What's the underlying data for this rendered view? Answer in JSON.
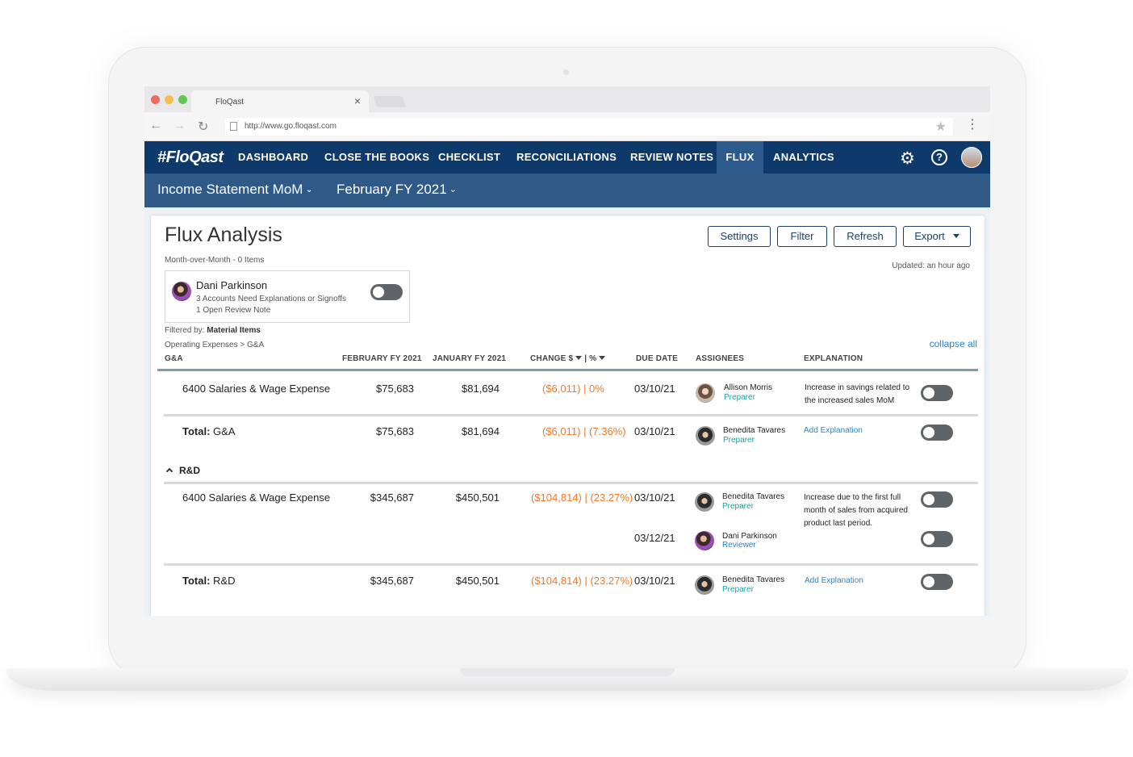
{
  "browser": {
    "tab_title": "FloQast",
    "tab_close": "×",
    "url": "http://www.go.floqast.com",
    "icons": {
      "back": "back-arrow-icon",
      "forward": "forward-arrow-icon",
      "reload": "reload-icon",
      "star": "star-icon",
      "menu": "kebab-menu-icon"
    },
    "window_dot_colors": [
      "#ee6a5f",
      "#f5be4f",
      "#62c554"
    ]
  },
  "app": {
    "logo": "#FloQast",
    "nav": [
      "DASHBOARD",
      "CLOSE THE BOOKS",
      "CHECKLIST",
      "RECONCILIATIONS",
      "REVIEW NOTES",
      "FLUX",
      "ANALYTICS"
    ],
    "active_nav": "FLUX",
    "help_glyph": "?",
    "subnav": {
      "statement": "Income Statement MoM",
      "period": "February FY 2021"
    },
    "colors": {
      "nav_bg": "#0e3a6b",
      "subnav_bg": "#2f5a88",
      "accent": "#2a86c9",
      "change_negative": "#ef7a2b",
      "role": "#1aa3a0"
    }
  },
  "page": {
    "title": "Flux Analysis",
    "subtitle": "Month-over-Month - 0 Items",
    "buttons": {
      "settings": "Settings",
      "filter": "Filter",
      "refresh": "Refresh",
      "export": "Export"
    },
    "updated": "Updated: an hour ago",
    "user_card": {
      "name": "Dani Parkinson",
      "line1": "3 Accounts Need Explanations or Signoffs",
      "line2": "1 Open Review Note",
      "toggle_on": false
    },
    "filtered_label": "Filtered by:",
    "filtered_value": "Material Items",
    "breadcrumb": "Operating Expenses > G&A",
    "collapse_all": "collapse all"
  },
  "table": {
    "columns": {
      "group": "G&A",
      "feb": "FEBRUARY FY 2021",
      "jan": "JANUARY FY 2021",
      "change": "CHANGE $",
      "change_sep": "| %",
      "due": "DUE DATE",
      "assignees": "ASSIGNEES",
      "explanation": "EXPLANATION"
    },
    "ga_row": {
      "account": "6400 Salaries & Wage Expense",
      "feb": "$75,683",
      "jan": "$81,694",
      "change": "($6,011) | 0%",
      "due": "03/10/21",
      "assignee": "Allison Morris",
      "role": "Preparer",
      "explanation": "Increase in savings related to the increased sales MoM"
    },
    "ga_total": {
      "label_bold": "Total:",
      "label": "G&A",
      "feb": "$75,683",
      "jan": "$81,694",
      "change": "($6,011) | (7.36%)",
      "due": "03/10/21",
      "assignee": "Benedita Tavares",
      "role": "Preparer",
      "explanation_link": "Add Explanation"
    },
    "rd_section": "R&D",
    "rd_row": {
      "account": "6400 Salaries & Wage Expense",
      "feb": "$345,687",
      "jan": "$450,501",
      "change": "($104,814) | (23.27%)",
      "due": "03/10/21",
      "assignee": "Benedita Tavares",
      "role": "Preparer",
      "due2": "03/12/21",
      "assignee2": "Dani Parkinson",
      "role2": "Reviewer",
      "explanation": "Increase due to the first full month of sales from acquired product last period."
    },
    "rd_total": {
      "label_bold": "Total:",
      "label": "R&D",
      "feb": "$345,687",
      "jan": "$450,501",
      "change": "($104,814) | (23.27%)",
      "due": "03/10/21",
      "assignee": "Benedita Tavares",
      "role": "Preparer",
      "explanation_link": "Add Explanation"
    }
  }
}
